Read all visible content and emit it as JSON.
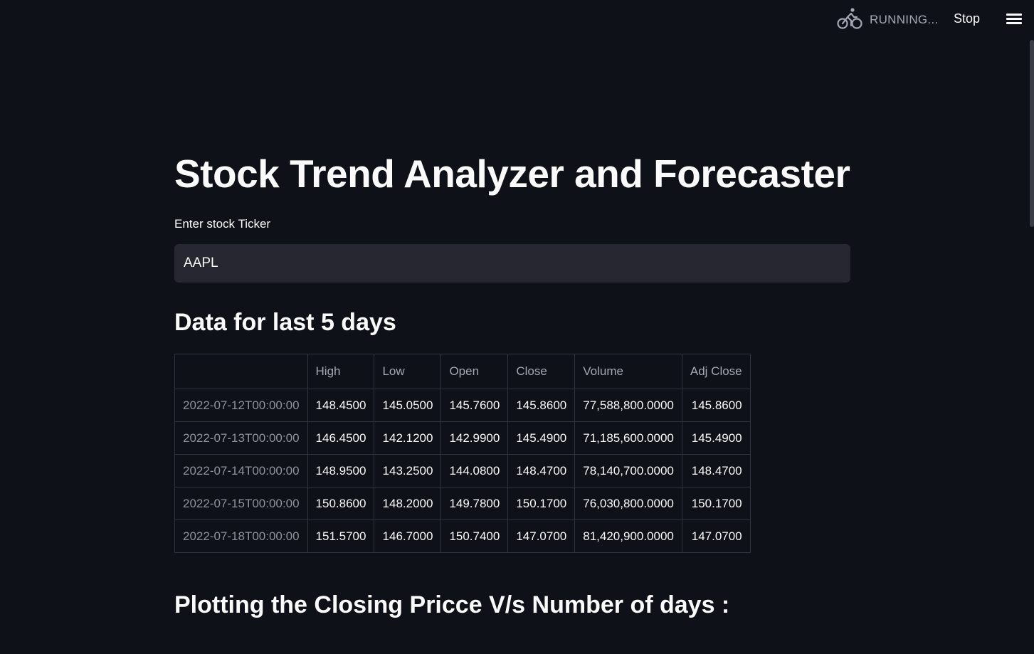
{
  "header": {
    "status_text": "RUNNING...",
    "stop_label": "Stop",
    "status_icon": "running-bicycle-icon",
    "menu_icon": "hamburger-menu-icon"
  },
  "main": {
    "title": "Stock Trend Analyzer and Forecaster",
    "input": {
      "label": "Enter stock Ticker",
      "value": "AAPL"
    },
    "data_heading": "Data for last 5 days",
    "table": {
      "columns": [
        "",
        "High",
        "Low",
        "Open",
        "Close",
        "Volume",
        "Adj Close"
      ],
      "rows": [
        {
          "index": "2022-07-12T00:00:00",
          "cells": [
            "148.4500",
            "145.0500",
            "145.7600",
            "145.8600",
            "77,588,800.0000",
            "145.8600"
          ]
        },
        {
          "index": "2022-07-13T00:00:00",
          "cells": [
            "146.4500",
            "142.1200",
            "142.9900",
            "145.4900",
            "71,185,600.0000",
            "145.4900"
          ]
        },
        {
          "index": "2022-07-14T00:00:00",
          "cells": [
            "148.9500",
            "143.2500",
            "144.0800",
            "148.4700",
            "78,140,700.0000",
            "148.4700"
          ]
        },
        {
          "index": "2022-07-15T00:00:00",
          "cells": [
            "150.8600",
            "148.2000",
            "149.7800",
            "150.1700",
            "76,030,800.0000",
            "150.1700"
          ]
        },
        {
          "index": "2022-07-18T00:00:00",
          "cells": [
            "151.5700",
            "146.7000",
            "150.7400",
            "147.0700",
            "81,420,900.0000",
            "147.0700"
          ]
        }
      ]
    },
    "plot_heading": "Plotting the Closing Pricce V/s Number of days :"
  },
  "colors": {
    "background": "#0e1117",
    "input_background": "#262730",
    "text": "#fafafa",
    "muted_text": "#a3a8b4",
    "border": "#31333f"
  }
}
